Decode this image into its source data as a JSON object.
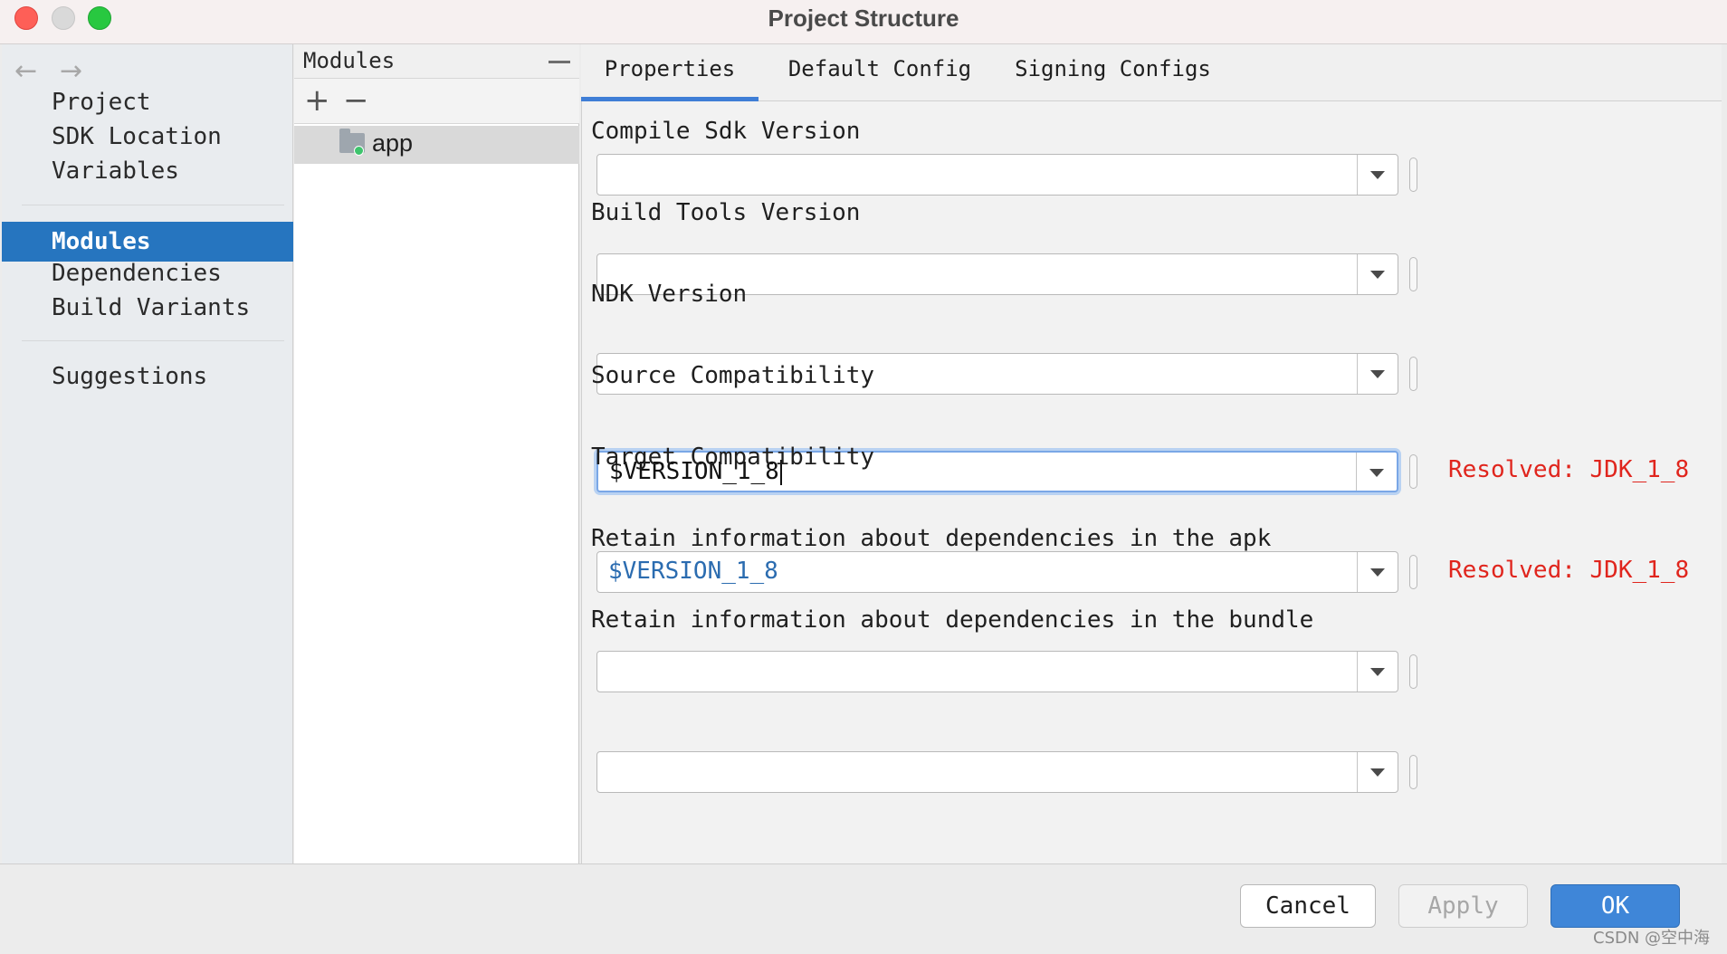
{
  "window": {
    "title": "Project Structure"
  },
  "nav": {
    "back_arrow": "←",
    "forward_arrow": "→",
    "items": [
      {
        "label": "Project"
      },
      {
        "label": "SDK Location"
      },
      {
        "label": "Variables"
      },
      {
        "label": "Modules",
        "selected": true
      },
      {
        "label": "Dependencies"
      },
      {
        "label": "Build Variants"
      },
      {
        "label": "Suggestions"
      }
    ]
  },
  "modules_panel": {
    "header": "Modules",
    "add_glyph": "+",
    "remove_glyph": "−",
    "items": [
      {
        "name": "app",
        "selected": true
      }
    ]
  },
  "tabs": [
    {
      "label": "Properties",
      "active": true
    },
    {
      "label": "Default Config"
    },
    {
      "label": "Signing Configs"
    }
  ],
  "fields": [
    {
      "label": "Compile Sdk Version",
      "value": ""
    },
    {
      "label": "Build Tools Version",
      "value": ""
    },
    {
      "label": "NDK Version",
      "value": ""
    },
    {
      "label": "Source Compatibility",
      "value": "$VERSION_1_8",
      "focused": true,
      "resolved": "Resolved: JDK_1_8"
    },
    {
      "label": "Target Compatibility",
      "value": "$VERSION_1_8",
      "resolved": "Resolved: JDK_1_8"
    },
    {
      "label": "Retain information about dependencies in the apk",
      "value": ""
    },
    {
      "label": "Retain information about dependencies in the bundle",
      "value": ""
    }
  ],
  "footer": {
    "cancel_label": "Cancel",
    "apply_label": "Apply",
    "ok_label": "OK"
  },
  "watermark": "CSDN @空中海",
  "colors": {
    "selection": "#2675bf",
    "resolved_text": "#e0251d",
    "reference_value": "#2b6cb0",
    "primary_button": "#3f86d8"
  },
  "icons": {
    "back": "arrow-left-icon",
    "forward": "arrow-right-icon",
    "module": "folder-icon",
    "dropdown": "chevron-down-icon"
  }
}
